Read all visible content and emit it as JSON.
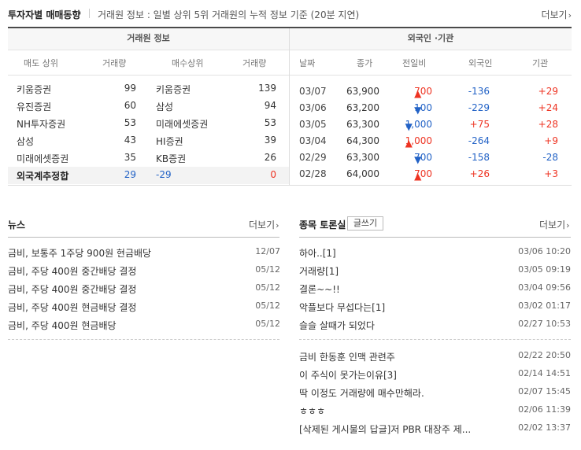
{
  "header": {
    "title": "투자자별 매매동향",
    "description": "거래원 정보 : 일별 상위 5위 거래원의 누적 정보 기준 (20분 지연)",
    "more": "더보기"
  },
  "broker": {
    "title": "거래원 정보",
    "cols": [
      "매도 상위",
      "거래량",
      "매수상위",
      "거래량"
    ],
    "rows": [
      {
        "sell": "키움증권",
        "sell_vol": "99",
        "buy": "키움증권",
        "buy_vol": "139"
      },
      {
        "sell": "유진증권",
        "sell_vol": "60",
        "buy": "삼성",
        "buy_vol": "94"
      },
      {
        "sell": "NH투자증권",
        "sell_vol": "53",
        "buy": "미래에셋증권",
        "buy_vol": "53"
      },
      {
        "sell": "삼성",
        "sell_vol": "43",
        "buy": "HI증권",
        "buy_vol": "39"
      },
      {
        "sell": "미래에셋증권",
        "sell_vol": "35",
        "buy": "KB증권",
        "buy_vol": "26"
      }
    ],
    "total": {
      "label": "외국계추정합",
      "sell_vol": "29",
      "buy": "-29",
      "buy_vol": "0"
    }
  },
  "foreign": {
    "title": "외국인 ·기관",
    "cols": [
      "날짜",
      "종가",
      "전일비",
      "외국인",
      "기관"
    ],
    "rows": [
      {
        "date": "03/07",
        "close": "63,900",
        "dir": "up",
        "change": "700",
        "foreign": "-136",
        "inst": "+29"
      },
      {
        "date": "03/06",
        "close": "63,200",
        "dir": "down",
        "change": "100",
        "foreign": "-229",
        "inst": "+24"
      },
      {
        "date": "03/05",
        "close": "63,300",
        "dir": "down",
        "change": "1,000",
        "foreign": "+75",
        "inst": "+28"
      },
      {
        "date": "03/04",
        "close": "64,300",
        "dir": "up",
        "change": "1,000",
        "foreign": "-264",
        "inst": "+9"
      },
      {
        "date": "02/29",
        "close": "63,300",
        "dir": "down",
        "change": "700",
        "foreign": "-158",
        "inst": "-28"
      },
      {
        "date": "02/28",
        "close": "64,000",
        "dir": "up",
        "change": "700",
        "foreign": "+26",
        "inst": "+3"
      }
    ]
  },
  "news": {
    "title": "뉴스",
    "more": "더보기",
    "items": [
      {
        "title": "금비, 보통주 1주당 900원 현금배당",
        "date": "12/07"
      },
      {
        "title": "금비, 주당 400원 중간배당 결정",
        "date": "05/12"
      },
      {
        "title": "금비, 주당 400원 중간배당 결정",
        "date": "05/12"
      },
      {
        "title": "금비, 주당 400원 현금배당 결정",
        "date": "05/12"
      },
      {
        "title": "금비, 주당 400원 현금배당",
        "date": "05/12"
      }
    ]
  },
  "board": {
    "title": "종목 토론실",
    "write": "글쓰기",
    "more": "더보기",
    "items": [
      {
        "title": "하아..[1]",
        "date": "03/06 10:20"
      },
      {
        "title": "거래량[1]",
        "date": "03/05 09:19"
      },
      {
        "title": "결론~~!!",
        "date": "03/04 09:56"
      },
      {
        "title": "악플보다 무섭다는[1]",
        "date": "03/02 01:17"
      },
      {
        "title": "슬슬 살때가 되었다",
        "date": "02/27 10:53"
      },
      {
        "title": "금비 한동훈 인맥 관련주",
        "date": "02/22 20:50"
      },
      {
        "title": "이 주식이 못가는이유[3]",
        "date": "02/14 14:51"
      },
      {
        "title": "딱 이정도 거래량에 매수만해라.",
        "date": "02/07 15:45"
      },
      {
        "title": "ㅎㅎㅎ",
        "date": "02/06 11:39"
      },
      {
        "title": "[삭제된 게시물의 답글]저 PBR 대장주 제...",
        "date": "02/02 13:37"
      }
    ]
  },
  "colors": {
    "up": "#e32222",
    "down": "#2262c6"
  }
}
